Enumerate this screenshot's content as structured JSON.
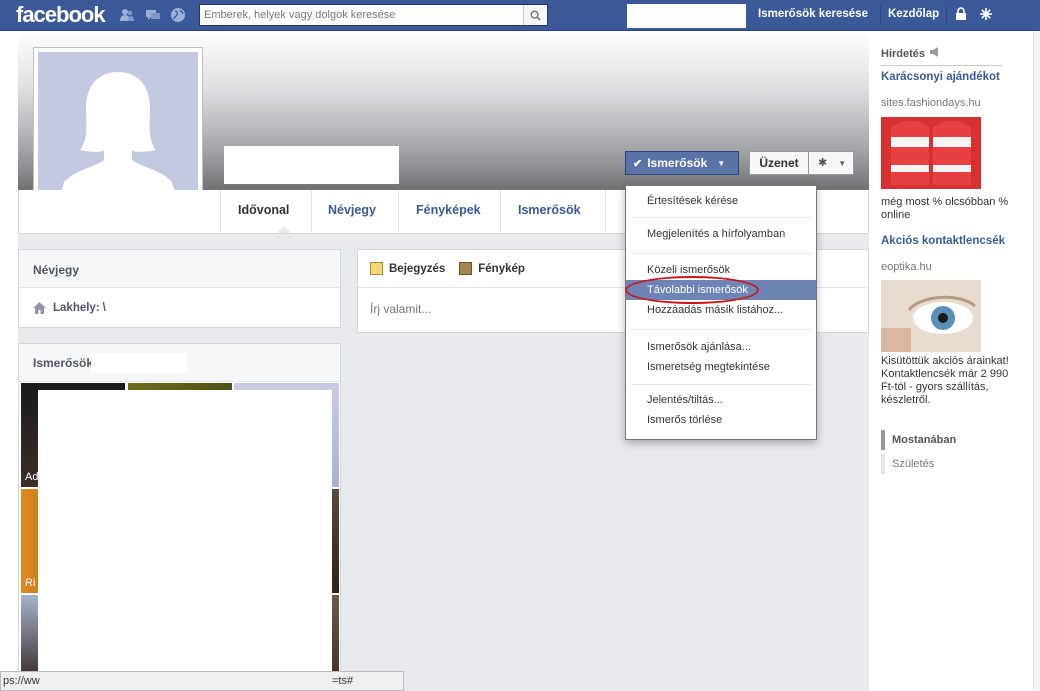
{
  "topbar": {
    "logo": "facebook",
    "search_placeholder": "Emberek, helyek vagy dolgok keresése",
    "find_friends": "Ismerősök keresése",
    "home": "Kezdőlap"
  },
  "profile": {
    "friends_button": "Ismerősök",
    "message_button": "Üzenet"
  },
  "tabs": [
    "Idővonal",
    "Névjegy",
    "Fényképek",
    "Ismerősök"
  ],
  "about_box": {
    "title": "Névjegy",
    "lives_label": "Lakhely:",
    "lives_value": "\\"
  },
  "friends_box": {
    "title": "Ismerősök"
  },
  "composer": {
    "post_tab": "Bejegyzés",
    "photo_tab": "Fénykép",
    "placeholder": "Írj valamit..."
  },
  "photo_captions": [
    "Ad",
    "Ri"
  ],
  "friends_menu": {
    "items": [
      "Értesítések kérése",
      "Megjelenítés a hírfolyamban",
      "Közeli ismerősök",
      "Távolabbi ismerősök",
      "Hozzáadás másik listához...",
      "Ismerősök ajánlása...",
      "Ismeretség megtekintése",
      "Jelentés/tiltás...",
      "Ismerős törlése"
    ],
    "highlighted_index": 3
  },
  "sidebar": {
    "ads_title": "Hirdetés",
    "ad1": {
      "name": "Karácsonyi ajándékot",
      "url": "sites.fashiondays.hu",
      "text": "még most % olcsóbban % online"
    },
    "ad2": {
      "name": "Akciós kontaktlencsék",
      "url": "eoptika.hu",
      "text": "Kisütöttük akciós árainkat! Kontaktlencsék már 2 990 Ft-tól - gyors szállítás, készletről."
    },
    "ticker_title": "Mostanában",
    "ticker_item": "Születés"
  },
  "statusbar": {
    "left": "ps://ww",
    "right": "=ts#"
  },
  "colors": {
    "brand_blue": "#3b5998",
    "highlight": "#6d84b4",
    "annotation_red": "#d01414"
  }
}
